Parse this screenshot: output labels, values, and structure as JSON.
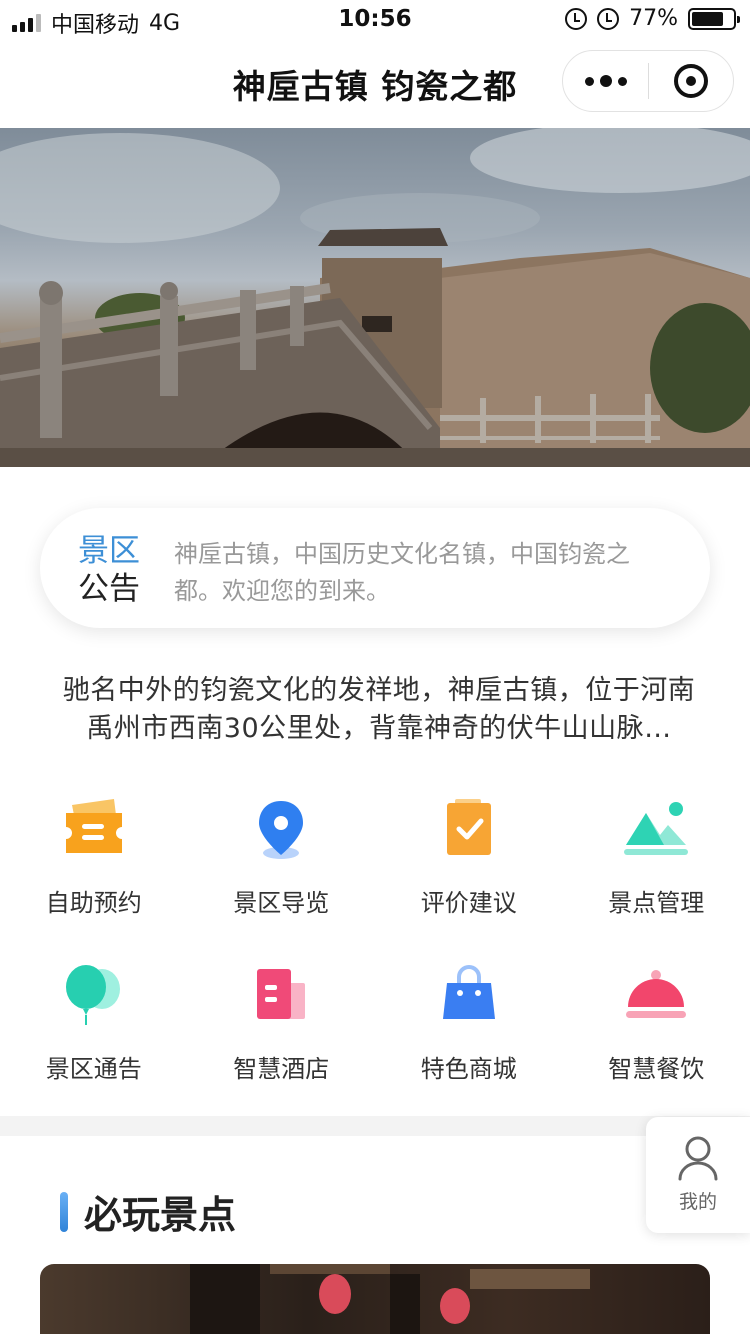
{
  "status": {
    "carrier": "中国移动",
    "network": "4G",
    "time": "10:56",
    "battery_text": "77%",
    "battery_level": 0.77
  },
  "nav": {
    "title": "神垕古镇 钧瓷之都"
  },
  "notice": {
    "label_line1": "景区",
    "label_line2": "公告",
    "text": "神垕古镇，中国历史文化名镇，中国钧瓷之都。欢迎您的到来。"
  },
  "intro": "驰名中外的钧瓷文化的发祥地，神垕古镇，位于河南禹州市西南30公里处，背靠神奇的伏牛山山脉…",
  "menu": [
    {
      "label": "自助预约",
      "icon": "ticket-icon",
      "color": "#f8a21d"
    },
    {
      "label": "景区导览",
      "icon": "location-pin-icon",
      "color": "#2f7ff0"
    },
    {
      "label": "评价建议",
      "icon": "checklist-icon",
      "color": "#f7a534"
    },
    {
      "label": "景点管理",
      "icon": "mountain-icon",
      "color": "#2ed3b4"
    },
    {
      "label": "景区通告",
      "icon": "balloon-icon",
      "color": "#27cfb0"
    },
    {
      "label": "智慧酒店",
      "icon": "hotel-icon",
      "color": "#f04a78"
    },
    {
      "label": "特色商城",
      "icon": "shopping-bag-icon",
      "color": "#3a7ef2"
    },
    {
      "label": "智慧餐饮",
      "icon": "food-cloche-icon",
      "color": "#f2466c"
    }
  ],
  "section": {
    "title": "必玩景点"
  },
  "float_button": {
    "label": "我的",
    "icon": "user-icon"
  }
}
